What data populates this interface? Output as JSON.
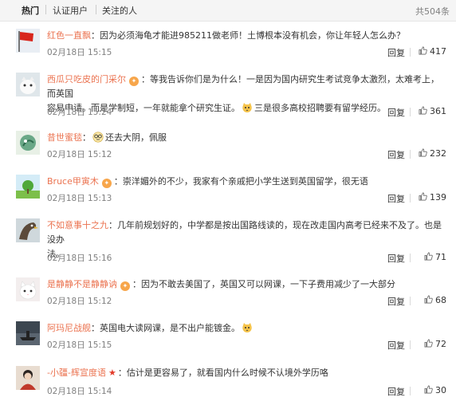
{
  "tabs": {
    "hot": "热门",
    "verified": "认证用户",
    "following": "关注的人",
    "total": "共504条"
  },
  "colors": {
    "username": "#eb7350",
    "meta": "#808080",
    "badge": "#f7a64b"
  },
  "comments": [
    {
      "user": "红色一直飘",
      "text": "：因为必须海龟才能进985211做老师！土博根本没有机会，你让年轻人怎么办？",
      "date": "02月18日 15:15",
      "reply": "回复",
      "likes": "417"
    },
    {
      "user": "西瓜只吃皮的门采尔",
      "text_a": "：等我告诉你们是为什么！一是因为国内研究生考试竞争太激烈，太难考上，而英国",
      "text_b": "容易申请。而是学制短，一年就能拿个研究生证。",
      "text_c": "三是很多高校招聘要有留学经历。",
      "date": "02月18日 15:24",
      "reply": "回复",
      "likes": "361"
    },
    {
      "user": "昔世蜜毯",
      "text_a": "：",
      "text_b": "还去大阴，佩服",
      "date": "02月18日 15:12",
      "reply": "回复",
      "likes": "232"
    },
    {
      "user": "Bruce甲寅木",
      "text": "：崇洋媚外的不少，我家有个亲戚把小学生送到英国留学，很无语",
      "date": "02月18日 15:13",
      "reply": "回复",
      "likes": "139"
    },
    {
      "user": "不如意事十之九",
      "text_a": "：几年前规划好的，中学都是按出国路线读的，现在改走国内高考已经来不及了。也是没办",
      "text_b": "法。",
      "date": "02月18日 15:16",
      "reply": "回复",
      "likes": "71"
    },
    {
      "user": "是静静不是静静讷",
      "text": "：因为不敢去美国了，英国又可以网课，一下子费用减少了一大部分",
      "date": "02月18日 15:12",
      "reply": "回复",
      "likes": "68"
    },
    {
      "user": "阿玛尼战舰",
      "text": "：英国电大读网课，是不出户能镀金。",
      "date": "02月18日 15:15",
      "reply": "回复",
      "likes": "72"
    },
    {
      "user": "-小疆-辉宣度语",
      "text": "：估计是更容易了，就看国内什么时候不认境外学历咯",
      "date": "02月18日 15:14",
      "reply": "回复",
      "likes": "30"
    }
  ]
}
